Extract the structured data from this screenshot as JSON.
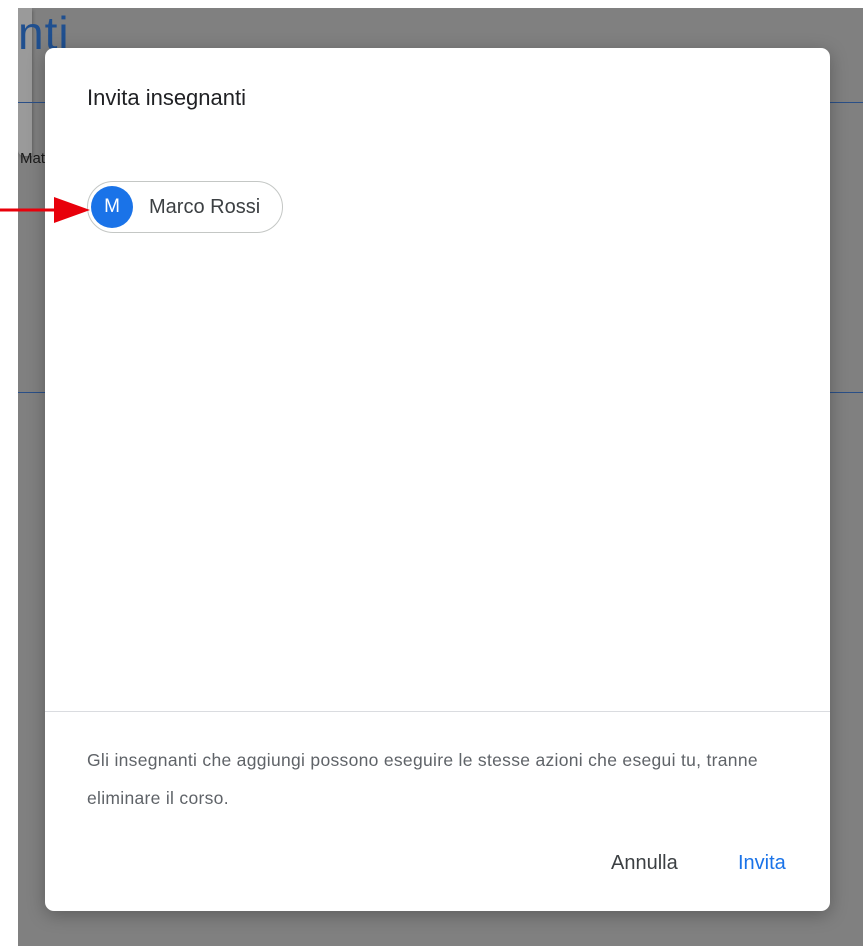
{
  "background": {
    "page_title_fragment": "nti",
    "text_fragment": "Mat"
  },
  "dialog": {
    "title": "Invita insegnanti",
    "chip": {
      "avatar_initial": "M",
      "name": "Marco Rossi",
      "avatar_color": "#1a73e8"
    },
    "info_text": "Gli insegnanti che aggiungi possono eseguire le stesse azioni che esegui tu, tranne eliminare il corso.",
    "buttons": {
      "cancel_label": "Annulla",
      "invite_label": "Invita"
    }
  },
  "annotation": {
    "arrow_color": "#e8000b"
  }
}
